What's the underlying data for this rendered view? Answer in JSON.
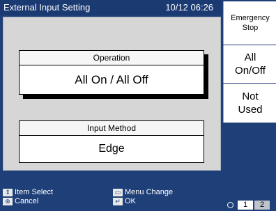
{
  "header": {
    "title": "External Input Setting",
    "datetime": "10/12 06:26"
  },
  "cards": {
    "operation": {
      "label": "Operation",
      "value": "All On / All Off"
    },
    "input_method": {
      "label": "Input Method",
      "value": "Edge"
    }
  },
  "side_buttons": {
    "emergency_line1": "Emergency",
    "emergency_line2": "Stop",
    "all_line1": "All",
    "all_line2": "On/Off",
    "not_line1": "Not",
    "not_line2": "Used"
  },
  "footer": {
    "item_select": "Item Select",
    "menu_change": "Menu Change",
    "cancel": "Cancel",
    "ok": "OK"
  },
  "pages": {
    "page1": "1",
    "page2": "2",
    "active": 1
  }
}
